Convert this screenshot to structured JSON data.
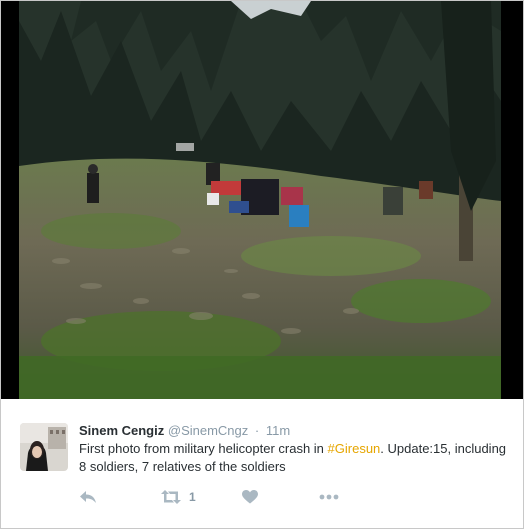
{
  "tweet": {
    "author_name": "Sinem Cengiz",
    "author_handle": "@SinemCngz",
    "separator": "·",
    "timestamp": "11m",
    "text_before": "First photo from military helicopter crash in ",
    "hashtag": "#Giresun",
    "text_after": ". Update:15, including 8 soldiers, 7 relatives of the soldiers",
    "hashtag_color": "#e6a600"
  },
  "actions": {
    "reply_icon": "reply-icon",
    "retweet_icon": "retweet-icon",
    "retweet_count": "1",
    "like_icon": "heart-icon",
    "more_icon": "more-dots-icon"
  },
  "colors": {
    "action_gray": "#aab8c2",
    "meta_gray": "#8899a6",
    "text": "#292f33"
  }
}
